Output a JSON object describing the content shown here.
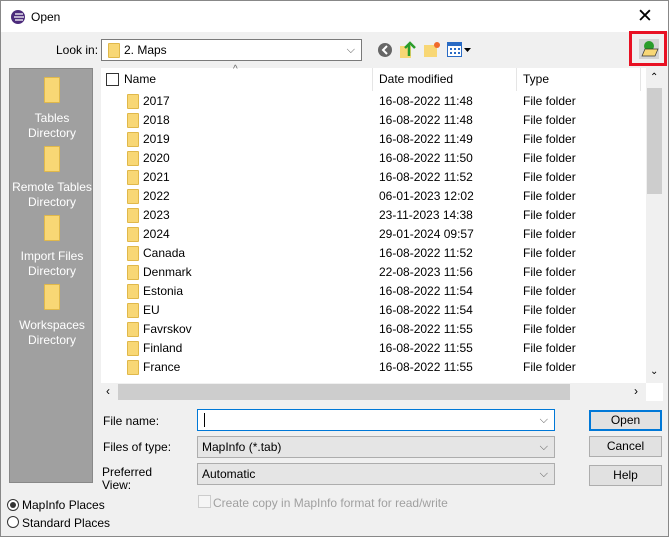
{
  "window": {
    "title": "Open",
    "close_icon": "close-icon",
    "app_icon": "mapinfo-logo-icon"
  },
  "toolbar": {
    "look_in_label": "Look in:",
    "look_in_value": "2. Maps",
    "icons": [
      "back-icon",
      "up-folder-icon",
      "new-folder-icon",
      "view-menu-icon"
    ],
    "highlight_button": "open-universal-data-icon",
    "highlight_color": "#e81123"
  },
  "sidebar": {
    "items": [
      {
        "label": "Tables Directory"
      },
      {
        "label": "Remote Tables Directory"
      },
      {
        "label": "Import Files Directory"
      },
      {
        "label": "Workspaces Directory"
      }
    ]
  },
  "list": {
    "columns": [
      "Name",
      "Date modified",
      "Type",
      "S"
    ],
    "rows": [
      {
        "name": "2017",
        "date": "16-08-2022 11:48",
        "type": "File folder"
      },
      {
        "name": "2018",
        "date": "16-08-2022 11:48",
        "type": "File folder"
      },
      {
        "name": "2019",
        "date": "16-08-2022 11:49",
        "type": "File folder"
      },
      {
        "name": "2020",
        "date": "16-08-2022 11:50",
        "type": "File folder"
      },
      {
        "name": "2021",
        "date": "16-08-2022 11:52",
        "type": "File folder"
      },
      {
        "name": "2022",
        "date": "06-01-2023 12:02",
        "type": "File folder"
      },
      {
        "name": "2023",
        "date": "23-11-2023 14:38",
        "type": "File folder"
      },
      {
        "name": "2024",
        "date": "29-01-2024 09:57",
        "type": "File folder"
      },
      {
        "name": "Canada",
        "date": "16-08-2022 11:52",
        "type": "File folder"
      },
      {
        "name": "Denmark",
        "date": "22-08-2023 11:56",
        "type": "File folder"
      },
      {
        "name": "Estonia",
        "date": "16-08-2022 11:54",
        "type": "File folder"
      },
      {
        "name": "EU",
        "date": "16-08-2022 11:54",
        "type": "File folder"
      },
      {
        "name": "Favrskov",
        "date": "16-08-2022 11:55",
        "type": "File folder"
      },
      {
        "name": "Finland",
        "date": "16-08-2022 11:55",
        "type": "File folder"
      },
      {
        "name": "France",
        "date": "16-08-2022 11:55",
        "type": "File folder"
      }
    ]
  },
  "form": {
    "file_name_label": "File name:",
    "file_name_value": "",
    "files_of_type_label": "Files of type:",
    "files_of_type_value": "MapInfo (*.tab)",
    "preferred_view_label": "Preferred View:",
    "preferred_view_value": "Automatic",
    "copy_checkbox_label": "Create copy in MapInfo format for read/write",
    "copy_checked": false
  },
  "buttons": {
    "open": "Open",
    "cancel": "Cancel",
    "help": "Help"
  },
  "places": {
    "mapinfo": "MapInfo Places",
    "standard": "Standard Places",
    "selected": "mapinfo"
  }
}
